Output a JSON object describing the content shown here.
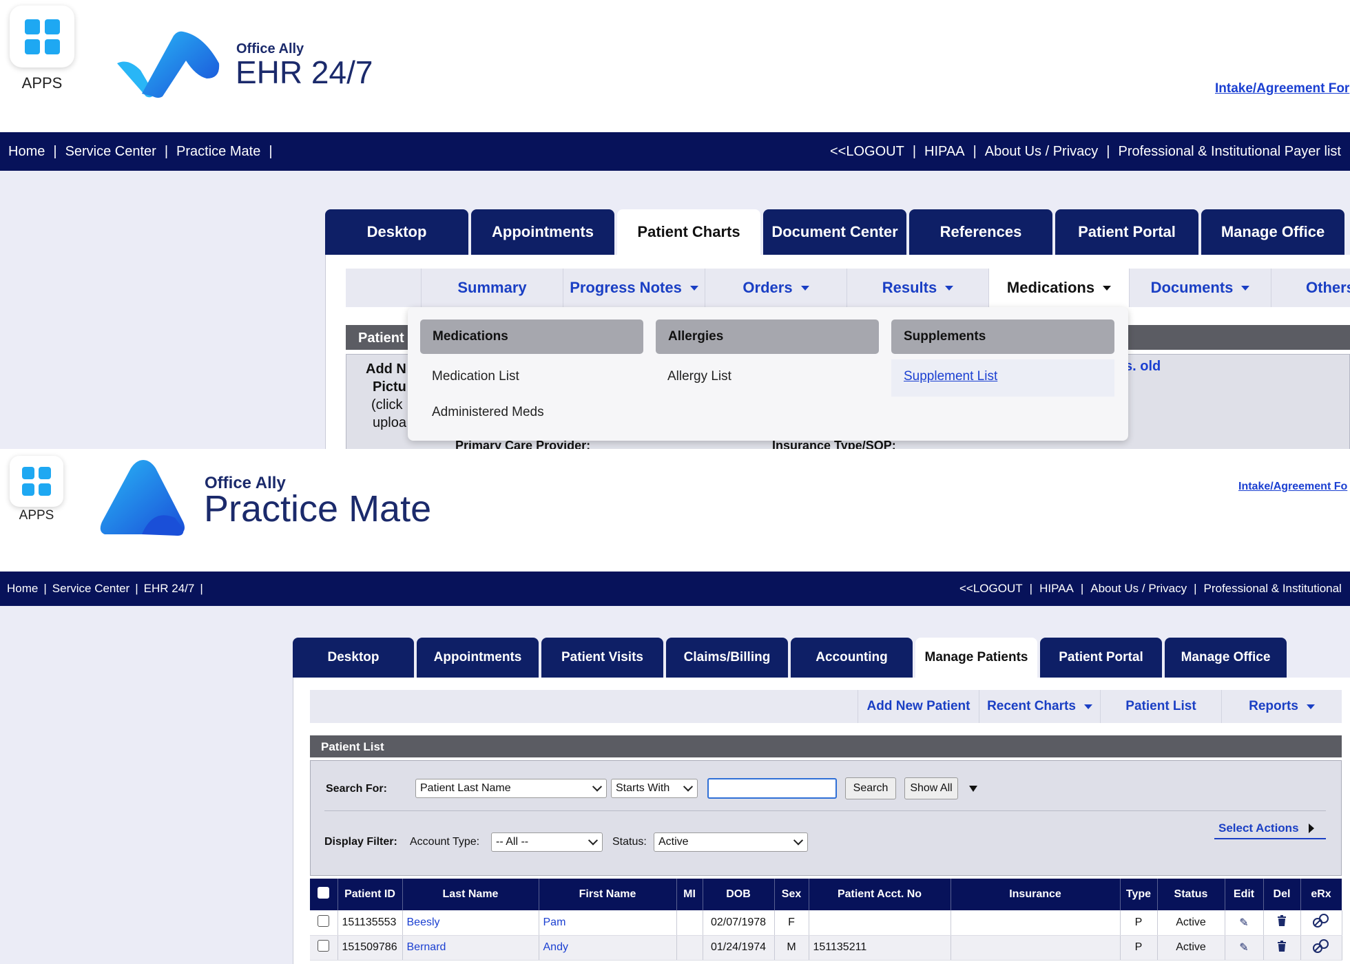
{
  "ehr": {
    "apps_label": "APPS",
    "brand": "Office Ally",
    "product": "EHR 24/7",
    "intake_link": "Intake/Agreement For",
    "nav_left": [
      "Home",
      "Service Center",
      "Practice Mate"
    ],
    "nav_right": [
      "<<LOGOUT",
      "HIPAA",
      "About Us / Privacy",
      "Professional & Institutional Payer list"
    ],
    "tabs": [
      "Desktop",
      "Appointments",
      "Patient Charts",
      "Document Center",
      "References",
      "Patient Portal",
      "Manage Office"
    ],
    "active_tab": "Patient Charts",
    "subnav": [
      "Summary",
      "Progress Notes",
      "Orders",
      "Results",
      "Medications",
      "Documents",
      "Others"
    ],
    "patient_bar": "Patient",
    "partial_text": {
      "add_new": "Add N",
      "picture": "Pictu",
      "click": "(click",
      "upload": "uploa",
      "yrs_old": "s. old",
      "primary_care": "Primary Care Provider:",
      "insurance_type": "Insurance Type/SOP:"
    },
    "dropdown": {
      "medications": {
        "title": "Medications",
        "items": [
          "Medication List",
          "Administered Meds"
        ]
      },
      "allergies": {
        "title": "Allergies",
        "items": [
          "Allergy List"
        ]
      },
      "supplements": {
        "title": "Supplements",
        "items": [
          "Supplement List"
        ]
      }
    }
  },
  "pm": {
    "apps_label": "APPS",
    "brand": "Office Ally",
    "product": "Practice Mate",
    "intake_link": "Intake/Agreement Fo",
    "nav_left": [
      "Home",
      "Service Center",
      "EHR 24/7"
    ],
    "nav_right": [
      "<<LOGOUT",
      "HIPAA",
      "About Us / Privacy",
      "Professional & Institutional"
    ],
    "tabs": [
      "Desktop",
      "Appointments",
      "Patient Visits",
      "Claims/Billing",
      "Accounting",
      "Manage Patients",
      "Patient Portal",
      "Manage Office"
    ],
    "active_tab": "Manage Patients",
    "subnav": [
      "Add New Patient",
      "Recent Charts",
      "Patient List",
      "Reports"
    ],
    "section_title": "Patient List",
    "search_for_label": "Search For:",
    "search_field_value": "Patient Last Name",
    "match_value": "Starts With",
    "search_input_value": "",
    "search_button": "Search",
    "show_all_button": "Show All",
    "display_filter_label": "Display Filter:",
    "account_type_label": "Account Type:",
    "account_type_value": "-- All --",
    "status_label": "Status:",
    "status_value": "Active",
    "select_actions": "Select Actions",
    "table": {
      "columns": [
        "",
        "Patient ID",
        "Last Name",
        "First Name",
        "MI",
        "DOB",
        "Sex",
        "Patient Acct. No",
        "Insurance",
        "Type",
        "Status",
        "Edit",
        "Del",
        "eRx"
      ],
      "rows": [
        {
          "id": "151135553",
          "last": "Beesly",
          "first": "Pam",
          "mi": "",
          "dob": "02/07/1978",
          "sex": "F",
          "acct": "",
          "insurance": "",
          "type": "P",
          "status": "Active"
        },
        {
          "id": "151509786",
          "last": "Bernard",
          "first": "Andy",
          "mi": "",
          "dob": "01/24/1974",
          "sex": "M",
          "acct": "151135211",
          "insurance": "",
          "type": "P",
          "status": "Active"
        }
      ]
    }
  },
  "icons": {
    "apps": "apps-grid-icon",
    "edit": "pencil-icon",
    "delete": "trash-icon",
    "erx": "pills-icon"
  },
  "colors": {
    "navy": "#07125a",
    "tab_navy": "#0e1f66",
    "link_blue": "#1a3fd1",
    "accent_blue": "#1ea8f2"
  }
}
